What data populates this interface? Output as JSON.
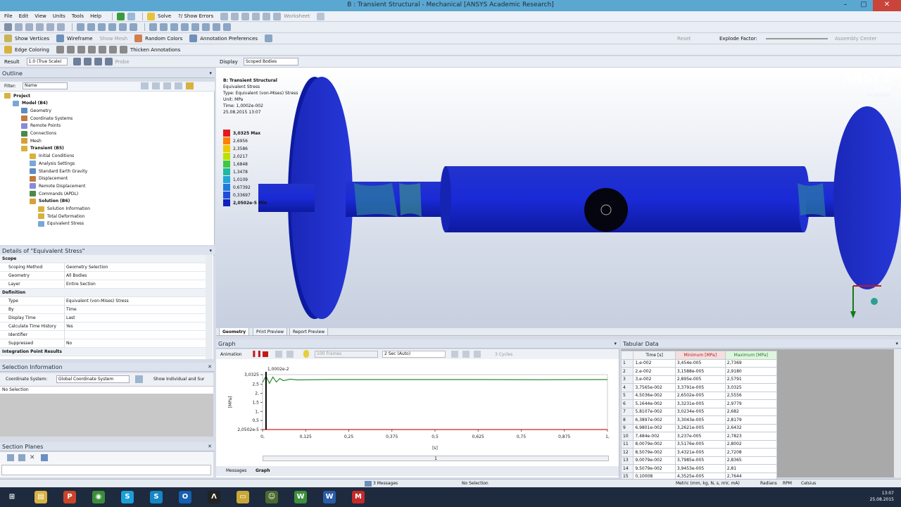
{
  "window": {
    "title": "B : Transient Structural - Mechanical [ANSYS Academic Research]"
  },
  "menu": {
    "items": [
      "File",
      "Edit",
      "View",
      "Units",
      "Tools",
      "Help"
    ],
    "solve": "Solve",
    "show_errors": "?/ Show Errors",
    "worksheet": "Worksheet"
  },
  "toolbar2": {
    "show_vertices": "Show Vertices",
    "wireframe": "Wireframe",
    "show_mesh": "Show Mesh",
    "random_colors": "Random Colors",
    "annotation_prefs": "Annotation Preferences",
    "reset": "Reset",
    "explode_factor": "Explode Factor:",
    "assembly_center": "Assembly Center"
  },
  "toolbar3": {
    "edge_coloring": "Edge Coloring",
    "thicken": "Thicken Annotations"
  },
  "toolbar4": {
    "result_label": "Result",
    "result_value": "1.0 (True Scale)",
    "probe": "Probe",
    "display_label": "Display",
    "display_value": "Scoped Bodies"
  },
  "outline": {
    "title": "Outline",
    "filter_label": "Filter:",
    "filter_value": "Name",
    "tree": [
      {
        "label": "Project",
        "bold": true,
        "level": 0
      },
      {
        "label": "Model (B4)",
        "bold": true,
        "level": 1
      },
      {
        "label": "Geometry",
        "bold": false,
        "level": 2
      },
      {
        "label": "Coordinate Systems",
        "bold": false,
        "level": 2
      },
      {
        "label": "Remote Points",
        "bold": false,
        "level": 2
      },
      {
        "label": "Connections",
        "bold": false,
        "level": 2
      },
      {
        "label": "Mesh",
        "bold": false,
        "level": 2
      },
      {
        "label": "Transient (B5)",
        "bold": true,
        "level": 2
      },
      {
        "label": "Initial Conditions",
        "bold": false,
        "level": 3
      },
      {
        "label": "Analysis Settings",
        "bold": false,
        "level": 3
      },
      {
        "label": "Standard Earth Gravity",
        "bold": false,
        "level": 3
      },
      {
        "label": "Displacement",
        "bold": false,
        "level": 3
      },
      {
        "label": "Remote Displacement",
        "bold": false,
        "level": 3
      },
      {
        "label": "Commands (APDL)",
        "bold": false,
        "level": 3
      },
      {
        "label": "Solution (B6)",
        "bold": true,
        "level": 3
      },
      {
        "label": "Solution Information",
        "bold": false,
        "level": 4
      },
      {
        "label": "Total Deformation",
        "bold": false,
        "level": 4
      },
      {
        "label": "Equivalent Stress",
        "bold": false,
        "level": 4
      }
    ]
  },
  "details": {
    "title": "Details of \"Equivalent Stress\"",
    "rows": [
      {
        "section": true,
        "k": "Scope",
        "v": ""
      },
      {
        "section": false,
        "k": "Scoping Method",
        "v": "Geometry Selection"
      },
      {
        "section": false,
        "k": "Geometry",
        "v": "All Bodies"
      },
      {
        "section": false,
        "k": "Layer",
        "v": "Entire Section"
      },
      {
        "section": true,
        "k": "Definition",
        "v": ""
      },
      {
        "section": false,
        "k": "Type",
        "v": "Equivalent (von-Mises) Stress"
      },
      {
        "section": false,
        "k": "By",
        "v": "Time"
      },
      {
        "section": false,
        "k": "Display Time",
        "v": "Last"
      },
      {
        "section": false,
        "k": "Calculate Time History",
        "v": "Yes"
      },
      {
        "section": false,
        "k": "Identifier",
        "v": ""
      },
      {
        "section": false,
        "k": "Suppressed",
        "v": "No"
      },
      {
        "section": true,
        "k": "Integration Point Results",
        "v": ""
      }
    ]
  },
  "selection": {
    "title": "Selection Information",
    "coord_label": "Coordinate System:",
    "coord_value": "Global Coordinate System",
    "show_individual": "Show Individual and Sur",
    "no_selection": "No Selection"
  },
  "section_planes": {
    "title": "Section Planes"
  },
  "viewport": {
    "info": [
      "B: Transient Structural",
      "Equivalent Stress",
      "Type: Equivalent (von-Mises) Stress",
      "Unit: MPa",
      "Time: 1,0002e-002",
      "25.08.2015 13:07"
    ],
    "legend": [
      "3,0325 Max",
      "2,6956",
      "2,3586",
      "2,0217",
      "1,6848",
      "1,3478",
      "1,0109",
      "0,67392",
      "0,33697",
      "2,0502e-5 Min"
    ],
    "legend_colors": [
      "#e31a1c",
      "#ff7f00",
      "#f0c800",
      "#b9e200",
      "#3fc83f",
      "#1fb8a0",
      "#1fa7d9",
      "#1f7ae0",
      "#1e4fd8",
      "#0f1fc0"
    ],
    "brand": "ANSYS",
    "version": "R16.0",
    "edition": "Academic"
  },
  "view_tabs": [
    "Geometry",
    "Print Preview",
    "Report Preview"
  ],
  "graph": {
    "title": "Graph",
    "animation_label": "Animation",
    "frames": "100 Frames",
    "duration": "2 Sec (Auto)",
    "cycles": "3 Cycles",
    "cursor_label": "1,0002e-2",
    "tabs": [
      "Messages",
      "Graph"
    ],
    "page": "1"
  },
  "chart_data": {
    "type": "line",
    "xlabel": "[s]",
    "ylabel": "[MPa]",
    "xlim": [
      0,
      1
    ],
    "ylim": [
      0,
      3.0325
    ],
    "x_ticks": [
      "0,",
      "0,125",
      "0,25",
      "0,375",
      "0,5",
      "0,625",
      "0,75",
      "0,875",
      "1,"
    ],
    "y_ticks": [
      "3,0325",
      "2,5",
      "2,",
      "1,5",
      "1,",
      "0,5",
      "2,0502e-5"
    ],
    "series": [
      {
        "name": "Maximum (MPa)",
        "color": "#2e8b2e",
        "x": [
          0,
          0.01,
          0.02,
          0.03,
          0.04,
          0.05,
          0.06,
          0.08,
          0.1,
          0.2,
          0.4,
          0.6,
          0.8,
          1.0
        ],
        "values": [
          2.6,
          2.95,
          2.55,
          2.9,
          2.62,
          2.82,
          2.7,
          2.78,
          2.74,
          2.76,
          2.76,
          2.76,
          2.75,
          2.76
        ]
      },
      {
        "name": "Minimum (MPa)",
        "color": "#d62020",
        "x": [
          0,
          0.5,
          1.0
        ],
        "values": [
          2e-05,
          2e-05,
          2e-05
        ]
      }
    ]
  },
  "tabular": {
    "title": "Tabular Data",
    "headers": [
      "",
      "Time [s]",
      "Minimum [MPa]",
      "Maximum [MPa]"
    ],
    "rows": [
      [
        "1",
        "1,e-002",
        "3,454e-005",
        "2,7369"
      ],
      [
        "2",
        "2,e-002",
        "3,1588e-005",
        "2,9180"
      ],
      [
        "3",
        "3,e-002",
        "2,895e-005",
        "2,5791"
      ],
      [
        "4",
        "3,7565e-002",
        "3,3791e-005",
        "3,0325"
      ],
      [
        "5",
        "4,5036e-002",
        "2,6502e-005",
        "2,5556"
      ],
      [
        "6",
        "5,1644e-002",
        "3,3231e-005",
        "2,9779"
      ],
      [
        "7",
        "5,8107e-002",
        "3,0234e-005",
        "2,682"
      ],
      [
        "8",
        "6,3897e-002",
        "3,3043e-005",
        "2,8179"
      ],
      [
        "9",
        "6,9801e-002",
        "3,2621e-005",
        "2,6432"
      ],
      [
        "10",
        "7,484e-002",
        "3,237e-005",
        "2,7823"
      ],
      [
        "11",
        "8,0079e-002",
        "3,5176e-005",
        "2,8002"
      ],
      [
        "12",
        "8,5079e-002",
        "3,4321e-005",
        "2,7208"
      ],
      [
        "13",
        "9,0079e-002",
        "3,7985e-005",
        "2,8365"
      ],
      [
        "14",
        "9,5079e-002",
        "3,9453e-005",
        "2,81"
      ],
      [
        "15",
        "0,10008",
        "4,3525e-005",
        "2,7644"
      ]
    ]
  },
  "status": {
    "messages": "3 Messages",
    "selection": "No Selection",
    "units": "Metric (mm, kg, N, s, mV, mA)",
    "radians": "Radians",
    "rpm": "RPM",
    "celsius": "Celsius"
  },
  "taskbar": {
    "apps": [
      {
        "name": "start",
        "glyph": "⊞",
        "color": "#1e2a3e"
      },
      {
        "name": "explorer",
        "glyph": "▤",
        "color": "#d9b342"
      },
      {
        "name": "powerpoint",
        "glyph": "P",
        "color": "#c8452c"
      },
      {
        "name": "chrome",
        "glyph": "◉",
        "color": "#3a8e3a"
      },
      {
        "name": "skype",
        "glyph": "S",
        "color": "#1a9fd9"
      },
      {
        "name": "skype2",
        "glyph": "S",
        "color": "#1786c4"
      },
      {
        "name": "outlook",
        "glyph": "O",
        "color": "#1560b0"
      },
      {
        "name": "ansys",
        "glyph": "Λ",
        "color": "#222222"
      },
      {
        "name": "folder",
        "glyph": "▭",
        "color": "#c9a838"
      },
      {
        "name": "person",
        "glyph": "☺",
        "color": "#4a6a30"
      },
      {
        "name": "workbench",
        "glyph": "W",
        "color": "#3c8f3c"
      },
      {
        "name": "word",
        "glyph": "W",
        "color": "#2a5ca8"
      },
      {
        "name": "mechanical",
        "glyph": "M",
        "color": "#c42a2a"
      }
    ],
    "time": "13:07",
    "date": "25.08.2015"
  }
}
